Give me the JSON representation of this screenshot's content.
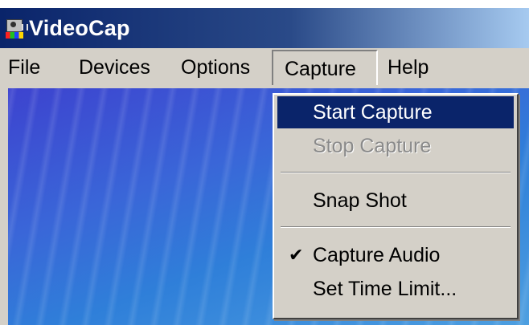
{
  "window": {
    "title": "VideoCap",
    "icon": "videocap-app-icon"
  },
  "menubar": {
    "items": [
      {
        "label": "File"
      },
      {
        "label": "Devices"
      },
      {
        "label": "Options"
      },
      {
        "label": "Capture",
        "open": true
      },
      {
        "label": "Help"
      }
    ]
  },
  "capture_menu": {
    "items": [
      {
        "label": "Start Capture",
        "state": "highlighted"
      },
      {
        "label": "Stop Capture",
        "state": "disabled"
      },
      {
        "label": "Snap Shot",
        "state": "normal"
      },
      {
        "label": "Capture Audio",
        "state": "checked",
        "icon": "checkmark-icon"
      },
      {
        "label": "Set Time Limit...",
        "state": "normal"
      }
    ]
  },
  "colors": {
    "titlebar_start": "#0a246a",
    "titlebar_end": "#a6caf0",
    "menu_background": "#d4d0c8",
    "highlight": "#0a246a",
    "disabled_text": "#8a8a8a"
  }
}
